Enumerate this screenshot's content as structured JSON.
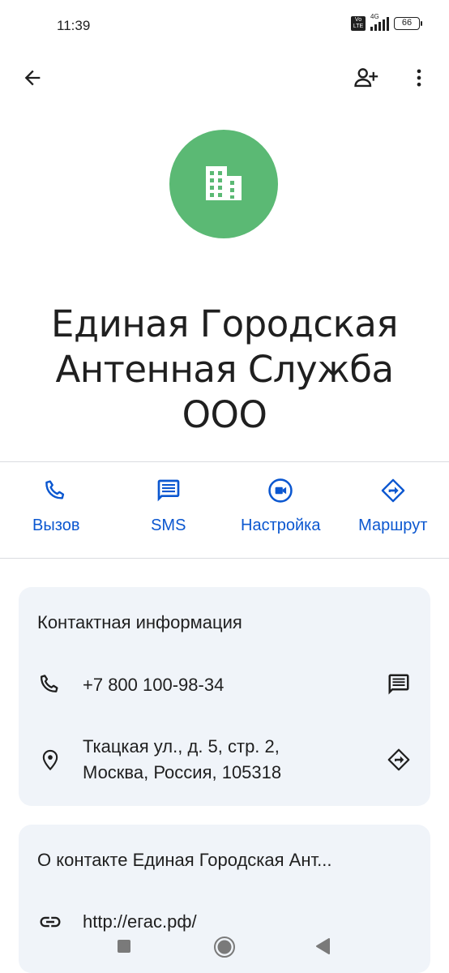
{
  "status": {
    "time": "11:39",
    "volte": "Vo LTE",
    "network": "4G",
    "battery": "66"
  },
  "contact": {
    "name_lines": [
      "Единая Городская",
      "Антенная Служба",
      "ООО"
    ],
    "avatar_color": "#5bb974"
  },
  "actions": [
    {
      "label": "Вызов",
      "icon": "phone-icon"
    },
    {
      "label": "SMS",
      "icon": "message-icon"
    },
    {
      "label": "Настройка",
      "icon": "video-icon"
    },
    {
      "label": "Маршрут",
      "icon": "directions-icon"
    }
  ],
  "contact_info": {
    "title": "Контактная информация",
    "phone": "+7 800 100-98-34",
    "address_line1": "Ткацкая ул., д. 5, стр. 2,",
    "address_line2": "Москва, Россия, 105318"
  },
  "about": {
    "title": "О контакте Единая Городская Ант...",
    "website": "http://егас.рф/"
  },
  "colors": {
    "accent": "#0b57d0",
    "card_bg": "#f0f4f9",
    "avatar": "#5bb974"
  }
}
